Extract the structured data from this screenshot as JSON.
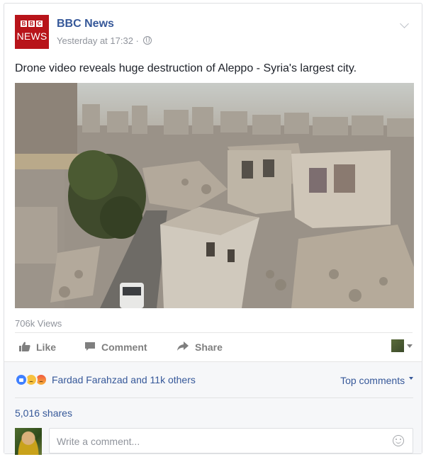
{
  "post": {
    "page_name": "BBC News",
    "timestamp": "Yesterday at 17:32 ·",
    "logo_letters": [
      "B",
      "B",
      "C"
    ],
    "logo_word": "NEWS",
    "text": "Drone video reveals huge destruction of Aleppo - Syria's largest city.",
    "views": "706k Views",
    "brand_color": "#b8141a"
  },
  "actions": {
    "like_label": "Like",
    "comment_label": "Comment",
    "share_label": "Share"
  },
  "reactions": {
    "icons": [
      "like-reaction",
      "sad-reaction",
      "angry-reaction"
    ],
    "summary": "Fardad Farahzad and 11k others",
    "sort_label": "Top comments"
  },
  "shares": "5,016 shares",
  "composer": {
    "placeholder": "Write a comment..."
  },
  "colors": {
    "link": "#365899",
    "muted": "#90949c",
    "footer_bg": "#f6f7f9"
  }
}
